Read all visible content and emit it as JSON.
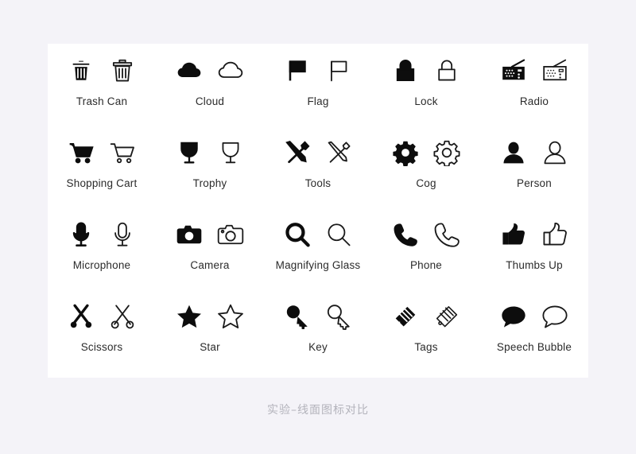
{
  "page": {
    "background_color": "#f4f3f8",
    "card_color": "#ffffff",
    "icon_color": "#0d0d0d",
    "label_color": "#2b2b2b",
    "caption_color": "#b3b3bb"
  },
  "caption": "实验–线面图标对比",
  "grid": {
    "columns": 5,
    "rows": 4,
    "pair_styles": [
      "solid",
      "outline"
    ]
  },
  "items": [
    {
      "label": "Trash Can",
      "icon": "trash-can-icon"
    },
    {
      "label": "Cloud",
      "icon": "cloud-icon"
    },
    {
      "label": "Flag",
      "icon": "flag-icon"
    },
    {
      "label": "Lock",
      "icon": "lock-icon"
    },
    {
      "label": "Radio",
      "icon": "radio-icon"
    },
    {
      "label": "Shopping Cart",
      "icon": "shopping-cart-icon"
    },
    {
      "label": "Trophy",
      "icon": "trophy-icon"
    },
    {
      "label": "Tools",
      "icon": "tools-icon"
    },
    {
      "label": "Cog",
      "icon": "cog-icon"
    },
    {
      "label": "Person",
      "icon": "person-icon"
    },
    {
      "label": "Microphone",
      "icon": "microphone-icon"
    },
    {
      "label": "Camera",
      "icon": "camera-icon"
    },
    {
      "label": "Magnifying Glass",
      "icon": "magnifying-glass-icon"
    },
    {
      "label": "Phone",
      "icon": "phone-icon"
    },
    {
      "label": "Thumbs Up",
      "icon": "thumbs-up-icon"
    },
    {
      "label": "Scissors",
      "icon": "scissors-icon"
    },
    {
      "label": "Star",
      "icon": "star-icon"
    },
    {
      "label": "Key",
      "icon": "key-icon"
    },
    {
      "label": "Tags",
      "icon": "tags-icon"
    },
    {
      "label": "Speech Bubble",
      "icon": "speech-bubble-icon"
    }
  ]
}
